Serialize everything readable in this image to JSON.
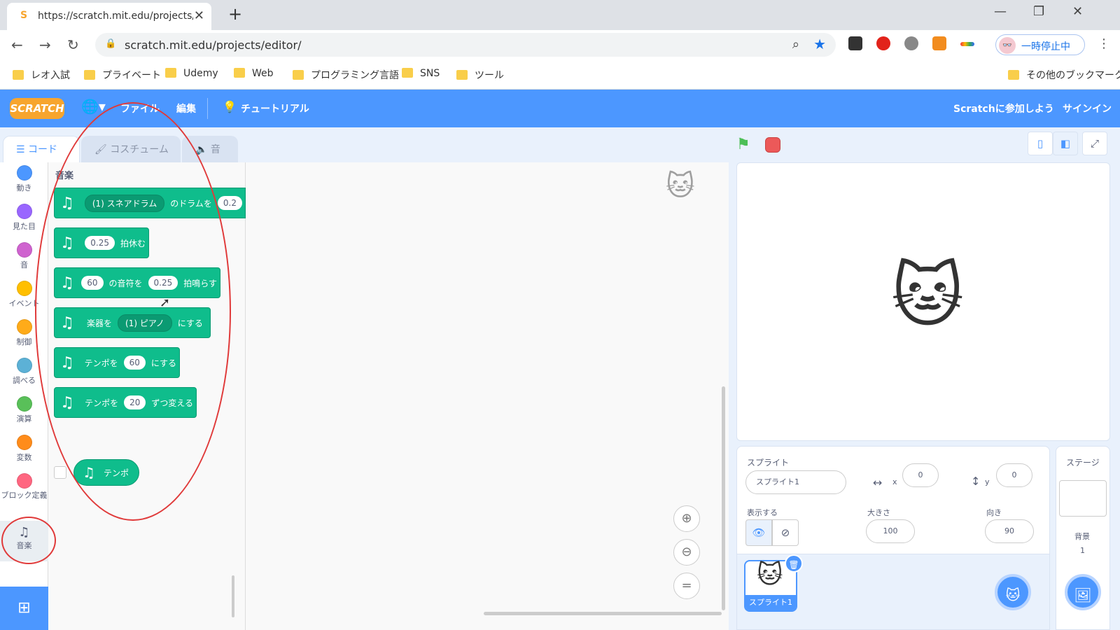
{
  "browser": {
    "tab_title": "https://scratch.mit.edu/projects/e",
    "url": "scratch.mit.edu/projects/editor/",
    "profile_label": "一時停止中",
    "bookmarks": [
      "レオ入試",
      "プライベート",
      "Udemy",
      "Web",
      "プログラミング言語",
      "SNS",
      "ツール"
    ],
    "other_bookmarks": "その他のブックマーク"
  },
  "menubar": {
    "logo": "SCRATCH",
    "file": "ファイル",
    "edit": "編集",
    "tutorial": "チュートリアル",
    "join": "Scratchに参加しよう",
    "signin": "サインイン"
  },
  "tabs": {
    "code": "コード",
    "costume": "コスチューム",
    "sound": "音"
  },
  "categories": [
    {
      "label": "動き",
      "color": "#4c97ff"
    },
    {
      "label": "見た目",
      "color": "#9966ff"
    },
    {
      "label": "音",
      "color": "#cf63cf"
    },
    {
      "label": "イベント",
      "color": "#ffbf00"
    },
    {
      "label": "制御",
      "color": "#ffab19"
    },
    {
      "label": "調べる",
      "color": "#5cb1d6"
    },
    {
      "label": "演算",
      "color": "#59c059"
    },
    {
      "label": "変数",
      "color": "#ff8c1a"
    },
    {
      "label": "ブロック定義",
      "color": "#ff6680"
    }
  ],
  "music_category": "音楽",
  "palette": {
    "heading": "音楽",
    "drum": {
      "drop": "(1) スネアドラム",
      "text": "のドラムを",
      "value": "0.2"
    },
    "rest": {
      "value": "0.25",
      "text": "拍休む"
    },
    "note": {
      "value1": "60",
      "text1": "の音符を",
      "value2": "0.25",
      "text2": "拍鳴らす"
    },
    "instrument": {
      "text1": "楽器を",
      "drop": "(1) ピアノ",
      "text2": "にする"
    },
    "set_tempo": {
      "text1": "テンポを",
      "value": "60",
      "text2": "にする"
    },
    "change_tempo": {
      "text1": "テンポを",
      "value": "20",
      "text2": "ずつ変える"
    },
    "tempo_reporter": "テンポ"
  },
  "sprite_info": {
    "sprite_label": "スプライト",
    "sprite_name": "スプライト1",
    "x_label": "x",
    "x_value": "0",
    "y_label": "y",
    "y_value": "0",
    "show_label": "表示する",
    "size_label": "大きさ",
    "size_value": "100",
    "direction_label": "向き",
    "direction_value": "90"
  },
  "sprite_list": [
    {
      "name": "スプライト1"
    }
  ],
  "stage_panel": {
    "title": "ステージ",
    "backdrop_label": "背景",
    "backdrop_count": "1"
  },
  "colors": {
    "scratch_blue": "#4c97ff",
    "music_green": "#0fbd8c",
    "annotation_red": "#e03a3a"
  }
}
